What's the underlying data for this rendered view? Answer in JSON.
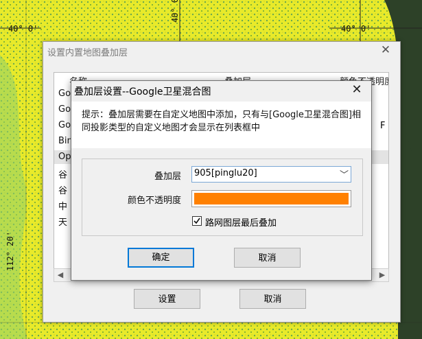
{
  "map": {
    "labels": [
      "40° 0'",
      "40° 0'",
      "40° 0'",
      "112° 20'"
    ]
  },
  "outer_dialog": {
    "title": "设置内置地图叠加层",
    "close_glyph": "✕",
    "columns": [
      "名称",
      "叠加层",
      "颜色不透明度"
    ],
    "rows": [
      "Go",
      "Go",
      "Go",
      "Bin",
      "Op",
      "谷",
      "谷",
      "中",
      "天"
    ],
    "cell_fragment": "F",
    "buttons": {
      "settings": "设置",
      "cancel": "取消"
    },
    "scroll_left": "◀",
    "scroll_right": "▶"
  },
  "inner_dialog": {
    "title": "叠加层设置--Google卫星混合图",
    "close_glyph": "✕",
    "hint": "提示：叠加层需要在自定义地图中添加，只有与[Google卫星混合图]相同投影类型的自定义地图才会显示在列表框中",
    "overlay_label": "叠加层",
    "overlay_value": "905[pinglu20]",
    "dropdown_glyph": "﹀",
    "opacity_label": "颜色不透明度",
    "opacity_color": "#ff8000",
    "checkbox_label": "路网图层最后叠加",
    "checkbox_checked": true,
    "buttons": {
      "ok": "确定",
      "cancel": "取消"
    }
  }
}
